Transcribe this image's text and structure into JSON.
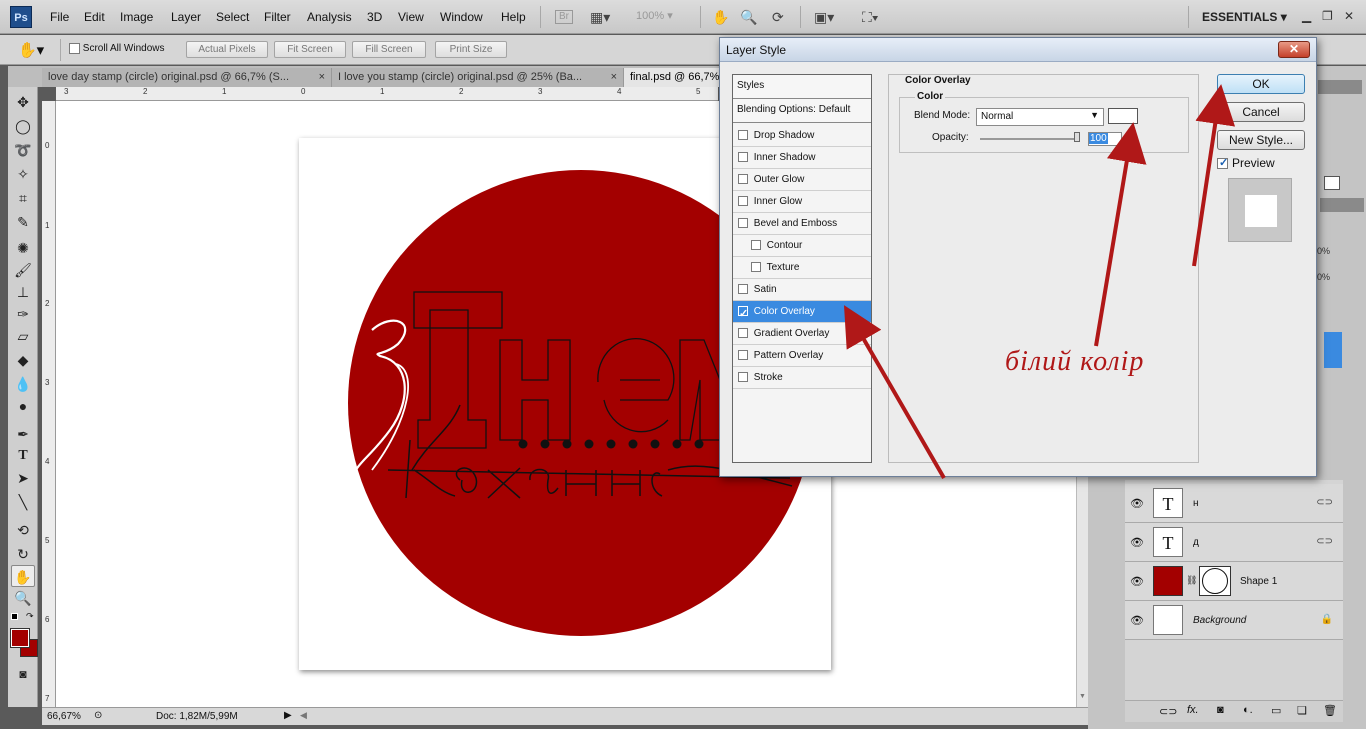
{
  "app": {
    "logo": "Ps",
    "workspace": "ESSENTIALS",
    "zoom": "100%"
  },
  "menu": [
    "File",
    "Edit",
    "Image",
    "Layer",
    "Select",
    "Filter",
    "Analysis",
    "3D",
    "View",
    "Window",
    "Help"
  ],
  "options_bar": {
    "scroll_all_windows": "Scroll All Windows",
    "actual_pixels": "Actual Pixels",
    "fit_screen": "Fit Screen",
    "fill_screen": "Fill Screen",
    "print_size": "Print Size"
  },
  "tabs": [
    {
      "label": "love day stamp (circle) original.psd @ 66,7% (S...",
      "active": false
    },
    {
      "label": "I love you stamp (circle) original.psd @ 25% (Ba...",
      "active": false
    },
    {
      "label": "final.psd @ 66,7% (S...",
      "active": true
    }
  ],
  "ruler_top": [
    "3",
    "2",
    "1",
    "0",
    "1",
    "2",
    "3",
    "4",
    "5"
  ],
  "ruler_left": [
    "0",
    "1",
    "2",
    "3",
    "4",
    "5",
    "6",
    "7"
  ],
  "status": {
    "zoom": "66,67%",
    "doc": "Doc: 1,82M/5,99M"
  },
  "artwork": {
    "circle_color": "#a30000",
    "script_text": "З",
    "word1": "Днем",
    "word2": "Кохання"
  },
  "dialog": {
    "title": "Layer Style",
    "styles_header": "Styles",
    "blending_options": "Blending Options: Default",
    "styles": [
      {
        "label": "Drop Shadow",
        "checked": false,
        "indent": false
      },
      {
        "label": "Inner Shadow",
        "checked": false,
        "indent": false
      },
      {
        "label": "Outer Glow",
        "checked": false,
        "indent": false
      },
      {
        "label": "Inner Glow",
        "checked": false,
        "indent": false
      },
      {
        "label": "Bevel and Emboss",
        "checked": false,
        "indent": false
      },
      {
        "label": "Contour",
        "checked": false,
        "indent": true
      },
      {
        "label": "Texture",
        "checked": false,
        "indent": true
      },
      {
        "label": "Satin",
        "checked": false,
        "indent": false
      },
      {
        "label": "Color Overlay",
        "checked": true,
        "indent": false,
        "selected": true
      },
      {
        "label": "Gradient Overlay",
        "checked": false,
        "indent": false
      },
      {
        "label": "Pattern Overlay",
        "checked": false,
        "indent": false
      },
      {
        "label": "Stroke",
        "checked": false,
        "indent": false
      }
    ],
    "section_title": "Color Overlay",
    "group_title": "Color",
    "blend_mode_label": "Blend Mode:",
    "blend_mode_value": "Normal",
    "overlay_color": "#ffffff",
    "opacity_label": "Opacity:",
    "opacity_value": "100",
    "opacity_unit": "%",
    "ok": "OK",
    "cancel": "Cancel",
    "new_style": "New Style...",
    "preview": "Preview"
  },
  "annotation": {
    "text": "білий колір",
    "color": "#b01818"
  },
  "layers": [
    {
      "name": "н",
      "type": "text"
    },
    {
      "name": "д",
      "type": "text"
    },
    {
      "name": "Shape 1",
      "type": "shape"
    },
    {
      "name": "Background",
      "type": "background"
    }
  ]
}
